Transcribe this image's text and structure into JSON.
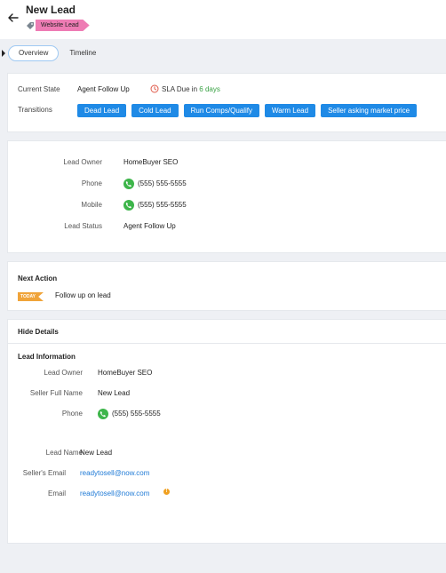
{
  "header": {
    "title": "New Lead",
    "tag": "Website Lead"
  },
  "tabs": [
    {
      "label": "Overview",
      "active": true
    },
    {
      "label": "Timeline",
      "active": false
    }
  ],
  "state": {
    "current_state_label": "Current State",
    "current_state_value": "Agent Follow Up",
    "sla_prefix": "SLA Due in",
    "sla_days": "6 days",
    "transitions_label": "Transitions",
    "transitions": [
      "Dead Lead",
      "Cold Lead",
      "Run Comps/Qualify",
      "Warm Lead",
      "Seller asking market price"
    ]
  },
  "owner_card": {
    "lead_owner_label": "Lead Owner",
    "lead_owner_value": "HomeBuyer SEO",
    "phone_label": "Phone",
    "phone_value": "(555) 555-5555",
    "mobile_label": "Mobile",
    "mobile_value": "(555) 555-5555",
    "lead_status_label": "Lead Status",
    "lead_status_value": "Agent Follow Up"
  },
  "next_action": {
    "title": "Next Action",
    "badge": "TODAY",
    "text": "Follow up on lead"
  },
  "details": {
    "toggle_label": "Hide Details",
    "section_title": "Lead Information",
    "lead_owner_label": "Lead Owner",
    "lead_owner_value": "HomeBuyer SEO",
    "seller_name_label": "Seller Full Name",
    "seller_name_value": "New Lead",
    "phone_label": "Phone",
    "phone_value": "(555) 555-5555",
    "lead_name_label": "Lead Name",
    "lead_name_value": "New Lead",
    "seller_email_label": "Seller's Email",
    "seller_email_value": "readytosell@now.com",
    "email_label": "Email",
    "email_value": "readytosell@now.com",
    "warning_glyph": "!"
  },
  "colors": {
    "accent": "#1f8ae6",
    "tag": "#ee7cb4",
    "sla_green": "#3aa245",
    "today_badge": "#f0a43a",
    "phone_icon": "#3db54a",
    "link": "#1f7ad6"
  },
  "icons": [
    "back-arrow-icon",
    "tag-icon",
    "clock-icon",
    "phone-icon",
    "warning-icon",
    "caret-icon"
  ]
}
